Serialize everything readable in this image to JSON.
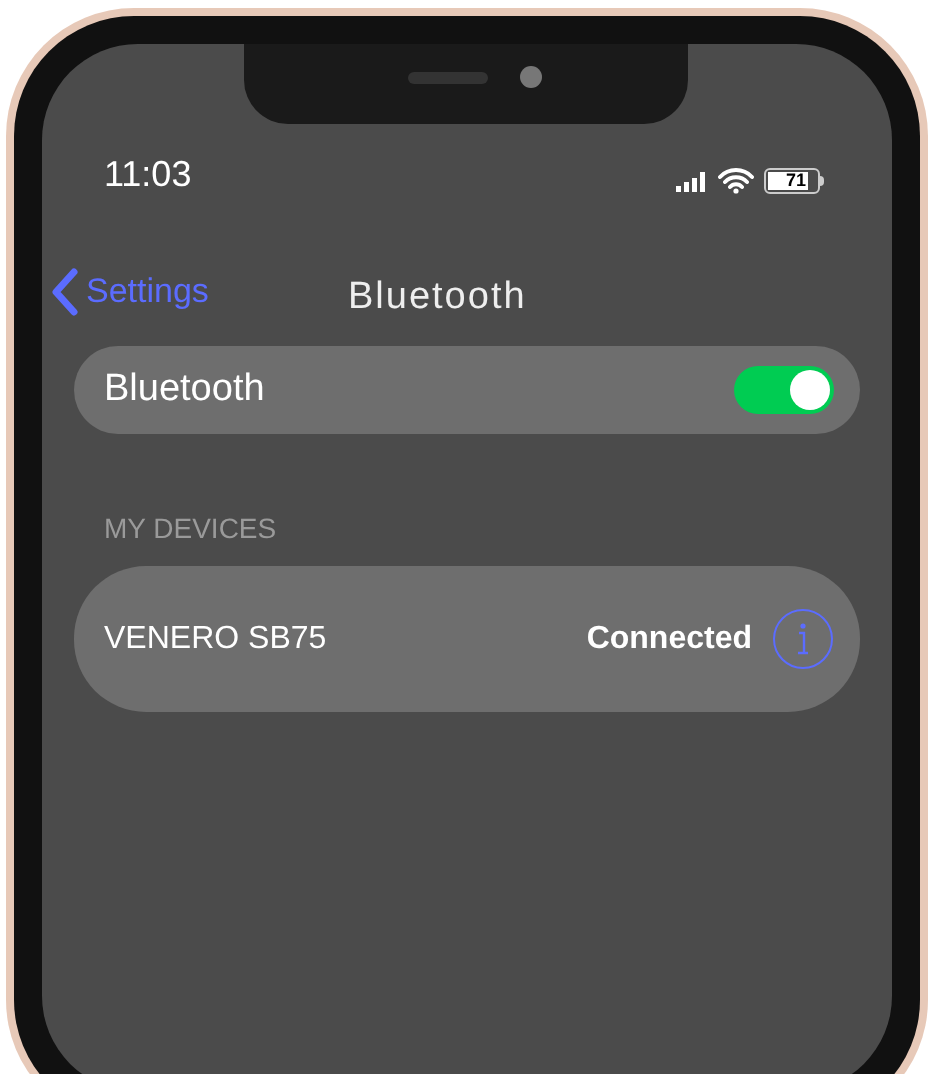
{
  "status_bar": {
    "time": "11:03",
    "battery_text": "71"
  },
  "nav": {
    "back_label": "Settings",
    "title": "Bluetooth"
  },
  "bluetooth_toggle": {
    "label": "Bluetooth",
    "on": true
  },
  "section": {
    "header": "MY DEVICES"
  },
  "devices": [
    {
      "name": "VENERO SB75",
      "status": "Connected"
    }
  ]
}
